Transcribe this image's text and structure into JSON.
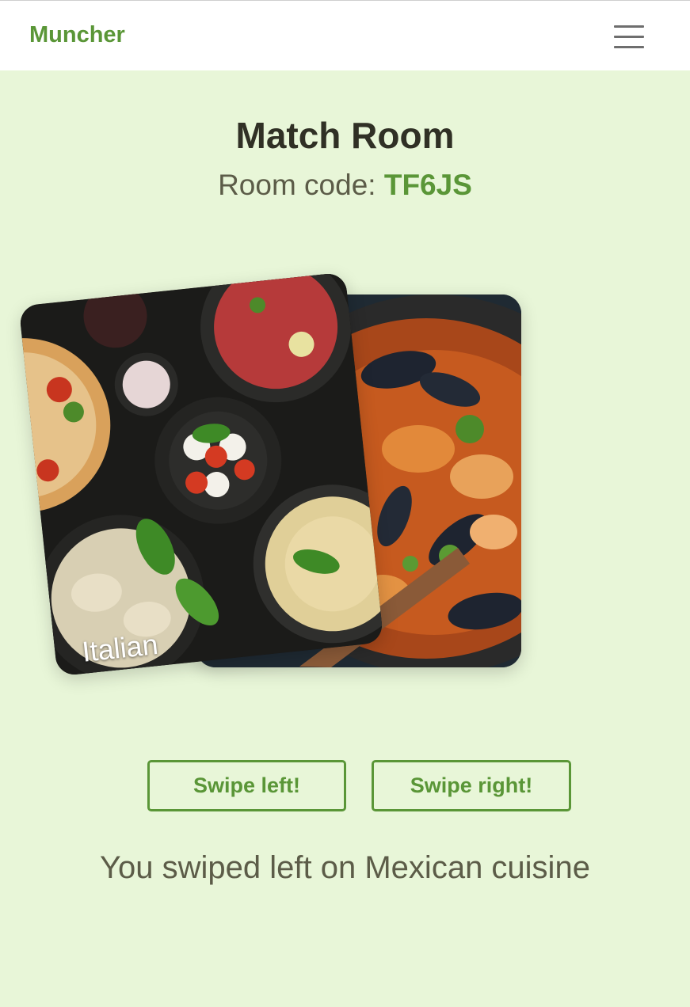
{
  "app": {
    "brand": "Muncher",
    "menu_icon": "hamburger-icon"
  },
  "room": {
    "title": "Match Room",
    "code_label": "Room code:",
    "code": "TF6JS"
  },
  "cards": {
    "front": {
      "label": "Italian",
      "image": "italian-food-image"
    },
    "back": {
      "image": "mussel-stew-image"
    }
  },
  "actions": {
    "swipe_left": "Swipe left!",
    "swipe_right": "Swipe right!"
  },
  "status": {
    "message": "You swiped left on Mexican cuisine"
  },
  "colors": {
    "accent": "#5a9637",
    "background": "#e8f6d8",
    "text": "#5c5c48"
  }
}
